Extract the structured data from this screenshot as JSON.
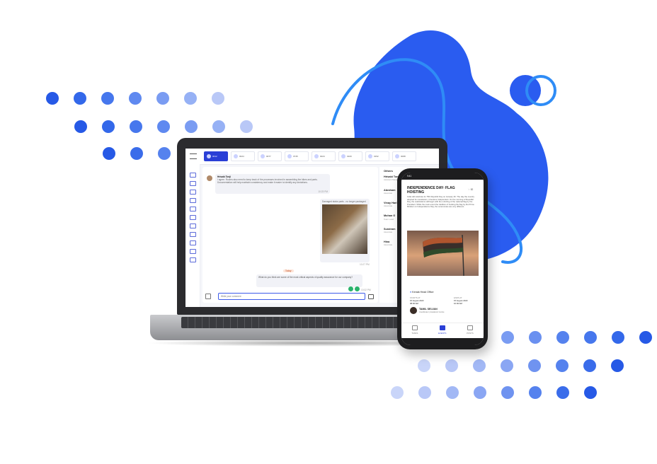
{
  "colors": {
    "brand_blue": "#2a5cf0",
    "accent_light": "#2f8cf6",
    "dot_dark": "#2659e6",
    "dot_light": "#b9c8f7"
  },
  "laptop": {
    "header_tiles": [
      {
        "label": "Announcements",
        "value": "0012",
        "active": true
      },
      {
        "label": "Birthdays",
        "value": "0024",
        "active": false
      },
      {
        "label": "Leave",
        "value": "0077",
        "active": false
      },
      {
        "label": "Holidays",
        "value": "0745",
        "active": false
      },
      {
        "label": "Events",
        "value": "0024",
        "active": false
      },
      {
        "label": "Rewards",
        "value": "0100",
        "active": false
      },
      {
        "label": "Polls",
        "value": "0152",
        "active": false
      },
      {
        "label": "Alerts",
        "value": "0068",
        "active": false
      }
    ],
    "chat": {
      "sender": "Hrisabi Tonji",
      "message": "I agree. Rooms also need to keep track of the processes involved in assembling the bikes and parts. Documentation will help maintain consistency and make it easier to identify any deviations.",
      "time1": "10:23 PM",
      "image_caption": "Damaged stator parts - no longer packaged",
      "time2": "10:27 PM",
      "date_divider": "Today",
      "question": "What do you think are some of the most critical aspects of quality assurance for our company?",
      "question_meta": "10:32 PM",
      "input_placeholder": "Write your comment"
    },
    "others": {
      "title": "Others",
      "people": [
        {
          "name": "Hrisabi Tonji",
          "role": "Assistant Manager"
        },
        {
          "name": "Abraham",
          "role": "Associate"
        },
        {
          "name": "Vinay Hari",
          "role": "Associate"
        },
        {
          "name": "Mohan G",
          "role": "Team Lead"
        },
        {
          "name": "Sundram",
          "role": "Associate"
        },
        {
          "name": "Hina",
          "role": "Associate"
        }
      ]
    }
  },
  "phone": {
    "status_time": "9:41",
    "event_title": "INDEPENDENCE DAY- FLAG HOISTING",
    "likes": "82",
    "description": "India will celebrate its 75th Republic Day on January 26. The day the country adopted its constitution, it became independent. On the morning of Republic Day, the celebrations will begin with the unfurling of the national flag by the President. While the main event the tradition of hoisting the flag by the Prime Minister on Independence Day, the ceremonies are very different.",
    "location": "Kerala Head Office",
    "starts_label": "STARTS AT",
    "starts_date": "15 August 2023",
    "starts_time": "08:00 AM",
    "ends_label": "ENDS AT",
    "ends_date": "15 August 2023",
    "ends_time": "10:00 AM",
    "organizer_name": "TAMIL SELVAN",
    "organizer_role": "Coordinator  |  Academic Centre",
    "nav": [
      {
        "label": "TASKS",
        "active": false
      },
      {
        "label": "EVENTS",
        "active": true
      },
      {
        "label": "POSTS",
        "active": false
      }
    ]
  }
}
